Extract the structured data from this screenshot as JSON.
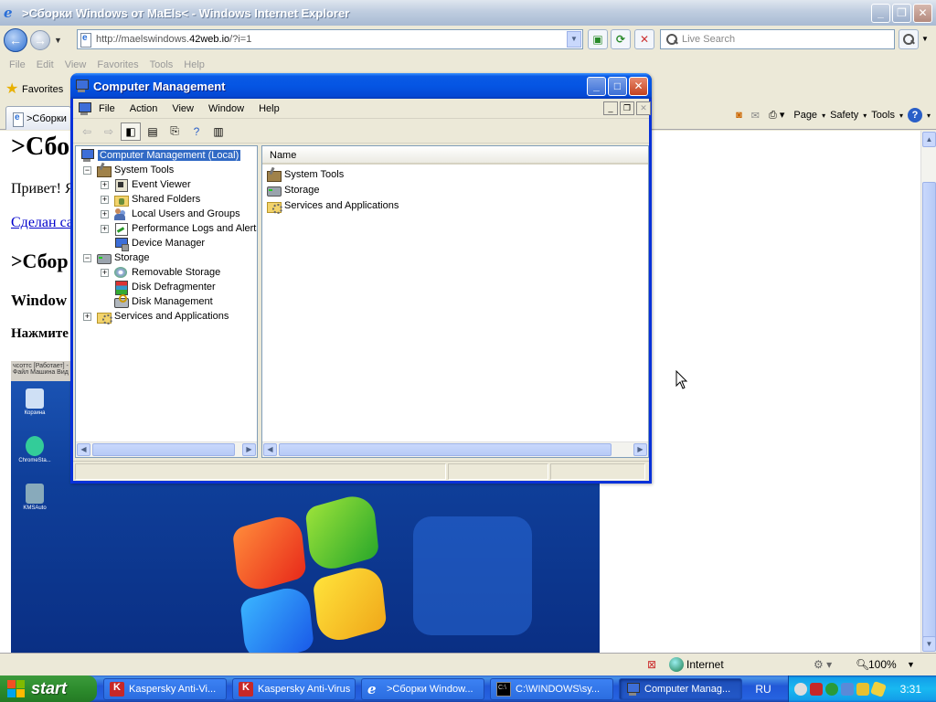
{
  "ie": {
    "title": ">Сборки Windows от MaEls< - Windows Internet Explorer",
    "address_plain": "http://maelswindows.",
    "address_domain": "42web.io",
    "address_rest": "/?i=1",
    "search_placeholder": "Live Search",
    "menu": [
      "File",
      "Edit",
      "View",
      "Favorites",
      "Tools",
      "Help"
    ],
    "favorites_label": "Favorites",
    "tab_label": ">Сборки",
    "commands": [
      "Page",
      "Safety",
      "Tools"
    ],
    "status_zone": "Internet",
    "zoom": "100%"
  },
  "page": {
    "h1": ">Сбо",
    "greeting": "Привет! Я",
    "link": "Сделан са",
    "h2": ">Сбор",
    "h3": "Window",
    "h4": "Нажмите",
    "shot_bar": "чсоттс [Работает] - Or",
    "shot_menu": "Файл  Машина  Вид",
    "desktop_icons": [
      "Корзина",
      "ChromeSta...",
      "KMSAuto"
    ]
  },
  "cm": {
    "title": "Computer Management",
    "menu": [
      "File",
      "Action",
      "View",
      "Window",
      "Help"
    ],
    "tree": {
      "root": "Computer Management (Local)",
      "system_tools": "System Tools",
      "event_viewer": "Event Viewer",
      "shared_folders": "Shared Folders",
      "local_users": "Local Users and Groups",
      "perf_logs": "Performance Logs and Alerts",
      "device_manager": "Device Manager",
      "storage": "Storage",
      "removable": "Removable Storage",
      "defrag": "Disk Defragmenter",
      "disk_mgmt": "Disk Management",
      "services": "Services and Applications"
    },
    "list_header": "Name",
    "list": [
      "System Tools",
      "Storage",
      "Services and Applications"
    ]
  },
  "taskbar": {
    "start": "start",
    "buttons": [
      "Kaspersky Anti-Vi...",
      "Kaspersky Anti-Virus",
      ">Сборки Window...",
      "C:\\WINDOWS\\sy...",
      "Computer Manag..."
    ],
    "lang": "RU",
    "clock": "3:31"
  }
}
